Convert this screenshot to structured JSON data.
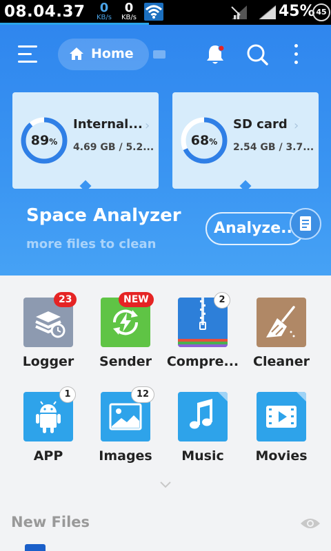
{
  "status_bar": {
    "time": "08.04.37",
    "net_down": {
      "value": "0",
      "unit": "KB/s"
    },
    "net_up": {
      "value": "0",
      "unit": "KB/s"
    },
    "battery": "45%",
    "notif_count": "45"
  },
  "header": {
    "home_label": "Home"
  },
  "storage": [
    {
      "name": "Internal...",
      "percent": "89",
      "percent_value": 89,
      "size": "4.69 GB / 5.2..."
    },
    {
      "name": "SD card",
      "percent": "68",
      "percent_value": 68,
      "size": "2.54 GB / 3.7..."
    }
  ],
  "percent_sign": "%",
  "space_analyzer": {
    "title": "Space Analyzer",
    "subtitle": "more files to clean",
    "button": "Analyze..."
  },
  "tools": [
    {
      "label": "Logger",
      "badge": "23",
      "badge_style": "red",
      "color": "#8d9ab0",
      "icon": "logger-icon"
    },
    {
      "label": "Sender",
      "badge": "NEW",
      "badge_style": "red",
      "color": "#5fc445",
      "icon": "sender-icon"
    },
    {
      "label": "Compre...",
      "badge": "2",
      "badge_style": "white",
      "color": "#2d7fd9",
      "icon": "compress-icon"
    },
    {
      "label": "Cleaner",
      "badge": "",
      "badge_style": "none",
      "color": "#b08866",
      "icon": "cleaner-icon"
    },
    {
      "label": "APP",
      "badge": "1",
      "badge_style": "white",
      "color": "#2ea3ea",
      "icon": "android-icon"
    },
    {
      "label": "Images",
      "badge": "12",
      "badge_style": "white",
      "color": "#2ea3ea",
      "icon": "image-icon"
    },
    {
      "label": "Music",
      "badge": "",
      "badge_style": "none",
      "color": "#2ea3ea",
      "icon": "music-icon"
    },
    {
      "label": "Movies",
      "badge": "",
      "badge_style": "none",
      "color": "#2ea3ea",
      "icon": "movie-icon"
    }
  ],
  "new_files": {
    "title": "New Files"
  }
}
